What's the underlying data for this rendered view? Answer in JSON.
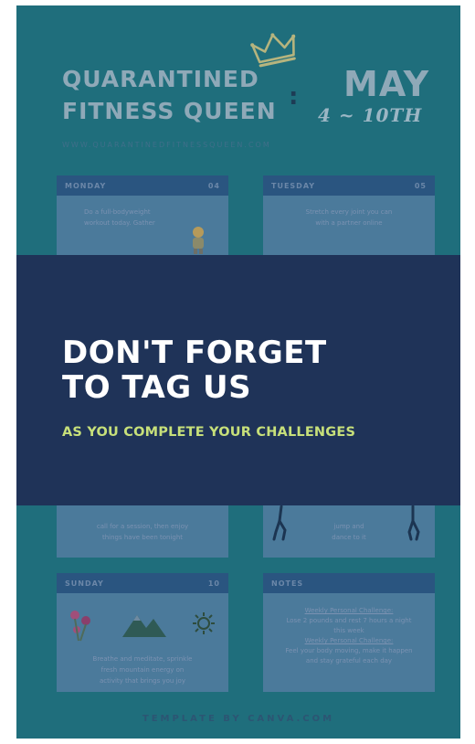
{
  "poster": {
    "title_line1": "QUARANTINED",
    "title_line2": "FITNESS QUEEN",
    "separator": ":",
    "month": "MAY",
    "date_range": "4 ~ 10TH",
    "url": "WWW.QUARANTINEDFITNESSQUEEN.COM",
    "footer": "TEMPLATE BY CANVA.COM",
    "colors": {
      "background": "#1f6e7c",
      "overlay": "#1f3358",
      "accent": "#c7e07a",
      "card_header": "#2a5580"
    }
  },
  "cards": {
    "monday": {
      "day": "MONDAY",
      "num": "04",
      "text1": "Do a full-bodyweight",
      "text2": "workout today. Gather",
      "icon": "woman-icon"
    },
    "tuesday": {
      "day": "TUESDAY",
      "num": "05",
      "text1": "Stretch every joint you can",
      "text2": "with a partner online",
      "text3": ""
    },
    "saturday_left": {
      "text1": "call for a session, then enjoy",
      "text2": "things have been tonight"
    },
    "saturday_right": {
      "text1": "jump and",
      "text2": "dance to it",
      "icon": "runner-icon"
    },
    "sunday": {
      "day": "SUNDAY",
      "num": "10",
      "text1": "Breathe and meditate, sprinkle",
      "text2": "fresh mountain energy on",
      "text3": "activity that brings you joy",
      "icons": [
        "flowers-icon",
        "mountain-icon",
        "sun-icon"
      ]
    },
    "notes": {
      "day": "NOTES",
      "line1": "Weekly Personal Challenge:",
      "line2": "Lose 2 pounds and rest 7 hours a night",
      "line3": "this week",
      "line4": "Weekly Personal Challenge:",
      "line5": "Feel your body moving, make it happen",
      "line6": "and stay grateful each day"
    }
  },
  "overlay": {
    "headline_line1": "DON'T FORGET",
    "headline_line2": "TO TAG US",
    "subline": "AS YOU COMPLETE YOUR CHALLENGES"
  }
}
